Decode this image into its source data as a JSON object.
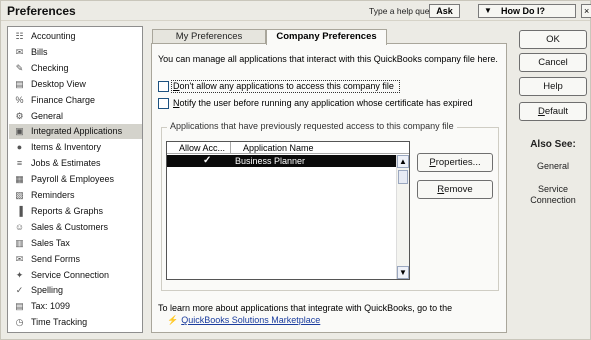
{
  "window": {
    "title": "Preferences",
    "help_prompt": "Type a help question",
    "ask_label": "Ask",
    "how_do_i_label": "How Do I?",
    "close_glyph": "×"
  },
  "sidebar": {
    "selected": "Integrated Applications",
    "items": [
      {
        "label": "Accounting",
        "icon": "accounting-icon",
        "glyph": "☷"
      },
      {
        "label": "Bills",
        "icon": "bills-icon",
        "glyph": "✉"
      },
      {
        "label": "Checking",
        "icon": "checking-icon",
        "glyph": "✎"
      },
      {
        "label": "Desktop View",
        "icon": "desktop-view-icon",
        "glyph": "▤"
      },
      {
        "label": "Finance Charge",
        "icon": "finance-charge-icon",
        "glyph": "%"
      },
      {
        "label": "General",
        "icon": "general-icon",
        "glyph": "⚙"
      },
      {
        "label": "Integrated Applications",
        "icon": "integrated-applications-icon",
        "glyph": "▣"
      },
      {
        "label": "Items & Inventory",
        "icon": "items-inventory-icon",
        "glyph": "●"
      },
      {
        "label": "Jobs & Estimates",
        "icon": "jobs-estimates-icon",
        "glyph": "≡"
      },
      {
        "label": "Payroll & Employees",
        "icon": "payroll-employees-icon",
        "glyph": "▦"
      },
      {
        "label": "Reminders",
        "icon": "reminders-icon",
        "glyph": "▧"
      },
      {
        "label": "Reports & Graphs",
        "icon": "reports-graphs-icon",
        "glyph": "▐"
      },
      {
        "label": "Sales & Customers",
        "icon": "sales-customers-icon",
        "glyph": "☺"
      },
      {
        "label": "Sales Tax",
        "icon": "sales-tax-icon",
        "glyph": "▥"
      },
      {
        "label": "Send Forms",
        "icon": "send-forms-icon",
        "glyph": "✉"
      },
      {
        "label": "Service Connection",
        "icon": "service-connection-icon",
        "glyph": "✦"
      },
      {
        "label": "Spelling",
        "icon": "spelling-icon",
        "glyph": "✓"
      },
      {
        "label": "Tax: 1099",
        "icon": "tax-1099-icon",
        "glyph": "▤"
      },
      {
        "label": "Time Tracking",
        "icon": "time-tracking-icon",
        "glyph": "◷"
      }
    ]
  },
  "tabs": {
    "my_preferences": "My Preferences",
    "company_preferences": "Company Preferences",
    "active": "Company Preferences"
  },
  "company_prefs": {
    "intro": "You can manage all applications that interact with this QuickBooks company file here.",
    "dont_allow_label": "Don't allow any applications to access this company file",
    "dont_allow_checked": false,
    "notify_label": "Notify the user before running any application whose certificate has expired",
    "notify_checked": false,
    "group_label": "Applications that have previously requested access to this company file",
    "table": {
      "columns": [
        "Allow Acc...",
        "Application Name"
      ],
      "rows": [
        {
          "allow": "✓",
          "name": "Business Planner",
          "selected": true
        }
      ]
    },
    "properties_label": "Properties...",
    "remove_label": "Remove",
    "footer_text": "To learn more about applications that integrate with QuickBooks, go to the",
    "marketplace_link": "QuickBooks Solutions Marketplace"
  },
  "dialog_buttons": {
    "ok": "OK",
    "cancel": "Cancel",
    "help": "Help",
    "default": "Default"
  },
  "see_also": {
    "title": "Also See:",
    "links": [
      "General",
      "Service Connection"
    ]
  }
}
